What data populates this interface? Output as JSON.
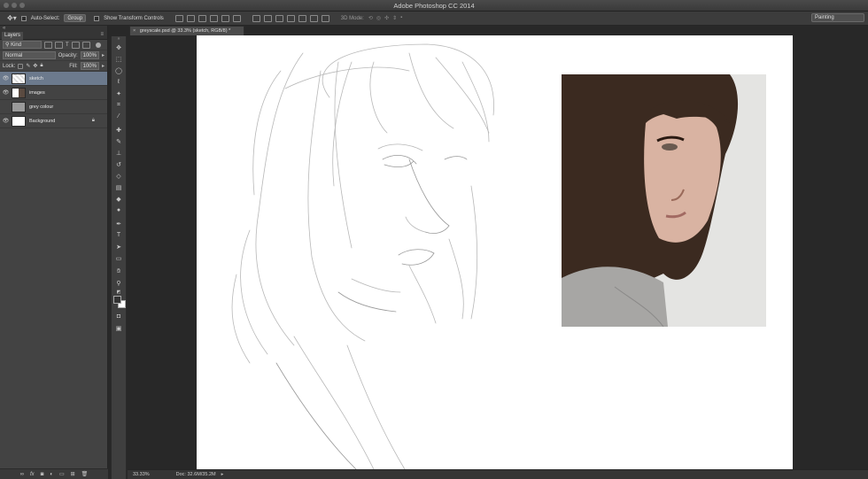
{
  "window": {
    "title": "Adobe Photoshop CC 2014"
  },
  "options_bar": {
    "auto_select_label": "Auto-Select:",
    "auto_select_value": "Group",
    "show_transform_label": "Show Transform Controls",
    "mode_3d_label": "3D Mode:",
    "workspace": "Painting"
  },
  "layers_panel": {
    "tab_label": "Layers",
    "filter_kind": "Kind",
    "blend_mode": "Normal",
    "opacity_label": "Opacity:",
    "opacity_value": "100%",
    "lock_label": "Lock:",
    "fill_label": "Fill:",
    "fill_value": "100%",
    "layers": [
      {
        "name": "sketch",
        "visible": true,
        "active": true
      },
      {
        "name": "images",
        "visible": true,
        "active": false
      },
      {
        "name": "grey colour",
        "visible": false,
        "active": false
      },
      {
        "name": "Background",
        "visible": true,
        "active": false,
        "locked": true
      }
    ]
  },
  "document": {
    "tab_title": "greyscale.psd @ 33.3% (sketch, RGB/8) *",
    "zoom": "33.33%",
    "doc_size": "Doc: 32.6M/35.2M"
  },
  "colors": {
    "canvas_bg": "#ffffff",
    "workspace_bg": "#282828",
    "active_layer": "#6c7a8d",
    "hair": "#3b2a20"
  }
}
